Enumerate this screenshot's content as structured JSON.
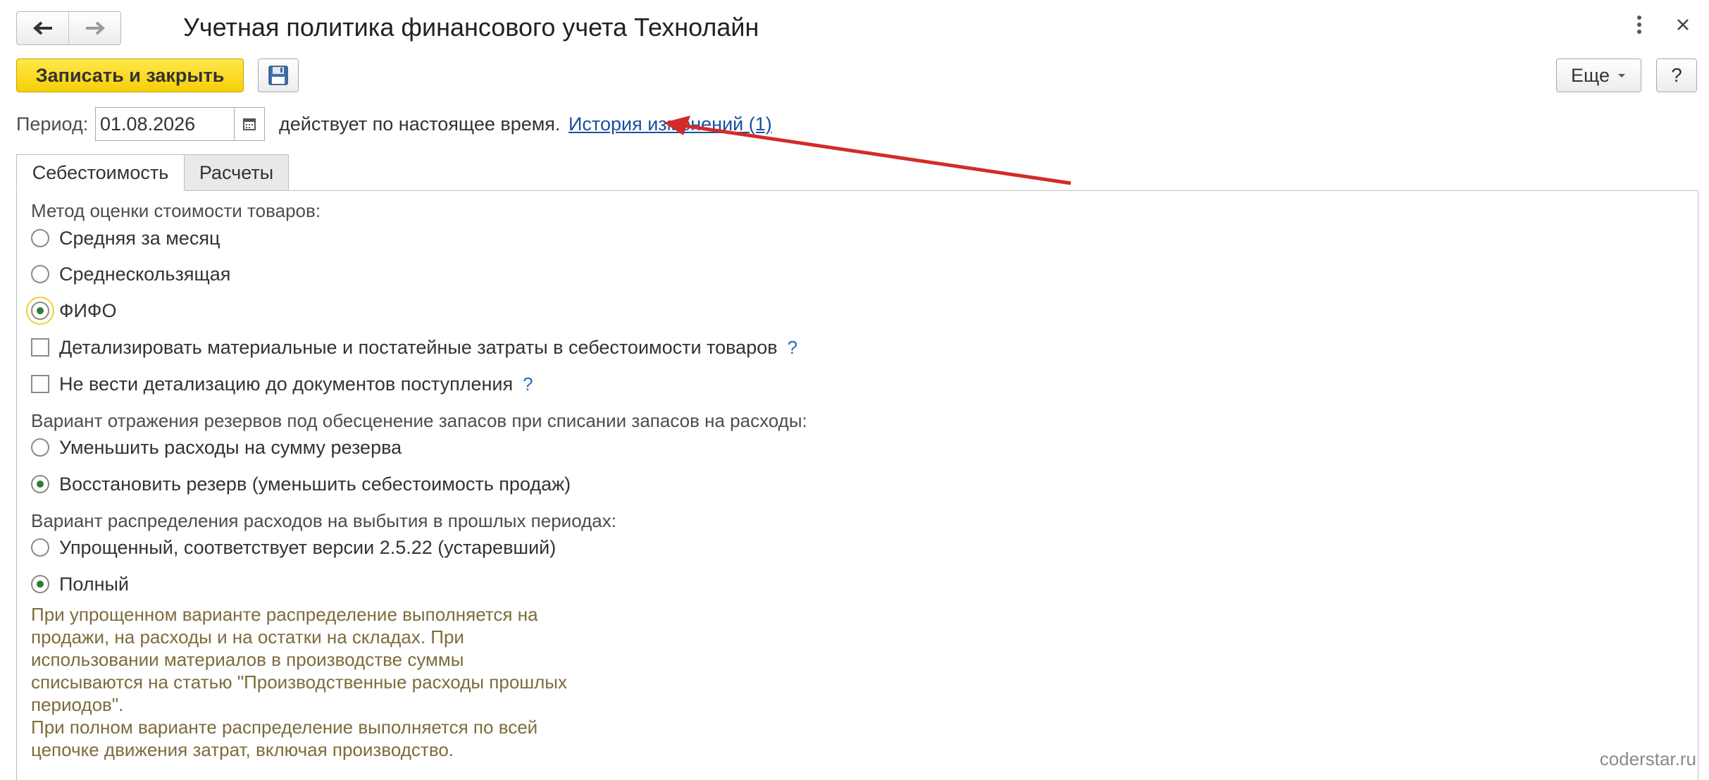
{
  "window": {
    "title": "Учетная политика финансового учета Технолайн",
    "menu_icon": "more-vertical-icon",
    "close_icon": "close-icon"
  },
  "nav": {
    "back_icon": "arrow-left-icon",
    "forward_icon": "arrow-right-icon"
  },
  "toolbar": {
    "save_close_label": "Записать и закрыть",
    "save_icon": "floppy-disk-icon",
    "more_label": "Еще",
    "help_label": "?"
  },
  "period": {
    "label": "Период:",
    "value": "01.08.2026",
    "status_text": "действует по настоящее время.",
    "history_link": "История изменений (1)"
  },
  "tabs": [
    {
      "label": "Себестоимость",
      "active": true
    },
    {
      "label": "Расчеты",
      "active": false
    }
  ],
  "cost": {
    "valuation_label": "Метод оценки стоимости товаров:",
    "valuation_options": [
      {
        "label": "Средняя за месяц",
        "selected": false
      },
      {
        "label": "Среднескользящая",
        "selected": false
      },
      {
        "label": "ФИФО",
        "selected": true
      }
    ],
    "checkboxes": [
      {
        "label": "Детализировать материальные и постатейные затраты в себестоимости товаров",
        "checked": false,
        "help": "?"
      },
      {
        "label": "Не вести детализацию до документов поступления",
        "checked": false,
        "help": "?"
      }
    ],
    "reserves_label": "Вариант отражения резервов под обесценение запасов при списании запасов на расходы:",
    "reserves_options": [
      {
        "label": "Уменьшить расходы на сумму резерва",
        "selected": false
      },
      {
        "label": "Восстановить резерв (уменьшить себестоимость продаж)",
        "selected": true
      }
    ],
    "distribution_label": "Вариант распределения расходов на выбытия в прошлых периодах:",
    "distribution_options": [
      {
        "label": "Упрощенный, соответствует версии 2.5.22 (устаревший)",
        "selected": false
      },
      {
        "label": "Полный",
        "selected": true
      }
    ],
    "hint_lines": [
      "При упрощенном варианте распределение выполняется на",
      "продажи, на расходы и на остатки на складах. При",
      "использовании материалов в производстве суммы",
      "списываются на статью \"Производственные расходы прошлых",
      "периодов\".",
      "При полном варианте распределение выполняется по всей",
      "цепочке движения затрат, включая производство."
    ]
  },
  "watermark": "coderstar.ru",
  "colors": {
    "primary_button": "#f5cf07",
    "link": "#1c4fa0",
    "hint_text": "#7d6c3b",
    "annotation_arrow": "#d42a2a",
    "radio_dot": "#2f7d32"
  }
}
